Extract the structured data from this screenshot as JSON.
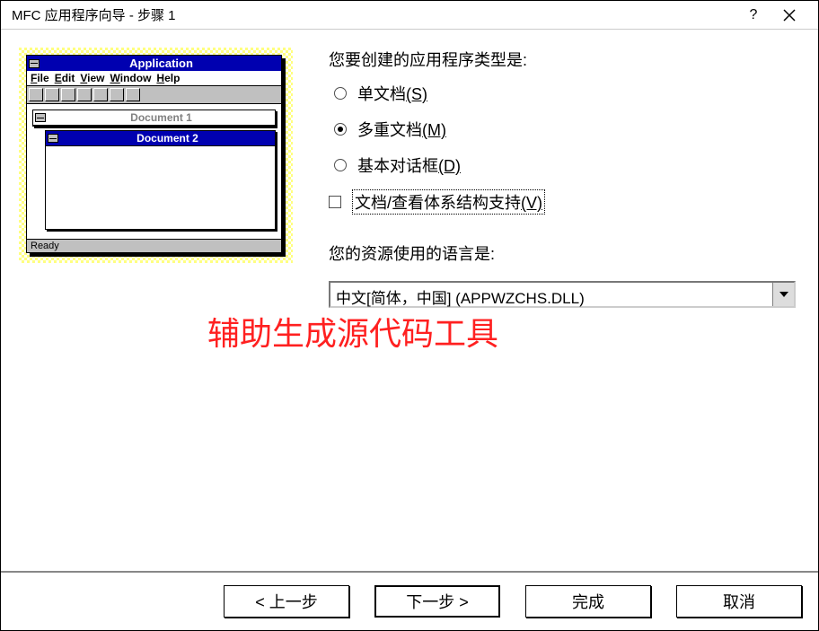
{
  "window": {
    "title": "MFC 应用程序向导 - 步骤 1"
  },
  "preview": {
    "app_title": "Application",
    "menu": {
      "file": "File",
      "edit": "Edit",
      "view": "View",
      "window": "Window",
      "help": "Help"
    },
    "doc1": "Document 1",
    "doc2": "Document 2",
    "status": "Ready"
  },
  "form": {
    "question_type": "您要创建的应用程序类型是:",
    "opt_single": "单文档",
    "opt_single_key": "(S)",
    "opt_multi": "多重文档",
    "opt_multi_key": "(M)",
    "opt_dialog": "基本对话框",
    "opt_dialog_key": "(D)",
    "check_docview_pre": "文档",
    "check_docview_mid": "/查看体系结构支持",
    "check_docview_key": "(V)",
    "lang_label": "您的资源使用的语言是:",
    "lang_value": "中文[简体，中国] (APPWZCHS.DLL)"
  },
  "annotation": "辅助生成源代码工具",
  "buttons": {
    "back": "< 上一步",
    "next": "下一步 >",
    "finish": "完成",
    "cancel": "取消"
  }
}
